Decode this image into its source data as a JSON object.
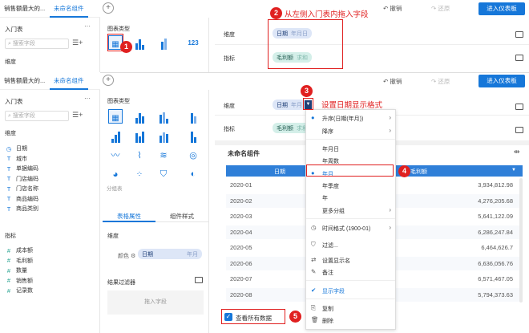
{
  "back_tabs": {
    "tab1": "销售额最大的...",
    "tab2": "未命名组件"
  },
  "back_header": {
    "undo": "撤销",
    "redo": "还原",
    "enter": "进入仪表板"
  },
  "back_left": {
    "title": "入门表",
    "search": "搜索字段",
    "dim": "维度"
  },
  "back_mid": {
    "chart_type": "图表类型"
  },
  "back_dims": {
    "row1": "维度",
    "row2": "指标",
    "chip1": "日期",
    "chip1_sub": "年月日",
    "chip2": "毛利额",
    "chip2_sub": "求和"
  },
  "front_tabs": {
    "tab1": "销售额最大的...",
    "tab2": "未命名组件"
  },
  "front_header": {
    "undo": "撤销",
    "redo": "还原",
    "enter": "进入仪表板"
  },
  "left": {
    "title": "入门表",
    "search": "搜索字段",
    "dim_label": "维度",
    "dims": [
      {
        "t": "T",
        "name": "日期",
        "kind": "date"
      },
      {
        "t": "T",
        "name": "城市"
      },
      {
        "t": "T",
        "name": "单据编码"
      },
      {
        "t": "T",
        "name": "门店编码"
      },
      {
        "t": "T",
        "name": "门店名称"
      },
      {
        "t": "T",
        "name": "商品编码"
      },
      {
        "t": "T",
        "name": "商品类别"
      }
    ],
    "metric_label": "指标",
    "metrics": [
      {
        "t": "#",
        "name": "成本额"
      },
      {
        "t": "#",
        "name": "毛利额"
      },
      {
        "t": "#",
        "name": "数量"
      },
      {
        "t": "#",
        "name": "销售额"
      },
      {
        "t": "#",
        "name": "记录数"
      }
    ]
  },
  "mid": {
    "chart_type": "图表类型",
    "group_label": "分组表",
    "tab_attr": "表格属性",
    "tab_style": "组件样式",
    "dim_label": "维度",
    "color_label": "颜色",
    "color_field": "日期",
    "color_sub": "年月",
    "filter_label": "结果过滤器",
    "drop_hint": "拖入字段"
  },
  "dims": {
    "row1": "维度",
    "row2": "指标",
    "chip1": "日期",
    "chip1_sub": "年月",
    "chip2": "毛利额",
    "chip2_sub": "求和"
  },
  "table": {
    "title": "未命名组件",
    "col1": "日期",
    "col2": "毛利额",
    "rows": [
      {
        "d": "2020-01",
        "v": "3,934,812.98"
      },
      {
        "d": "2020-02",
        "v": "4,276,205.68"
      },
      {
        "d": "2020-03",
        "v": "5,641,122.09"
      },
      {
        "d": "2020-04",
        "v": "6,286,247.84"
      },
      {
        "d": "2020-05",
        "v": "6,464,626.7"
      },
      {
        "d": "2020-06",
        "v": "6,636,056.76"
      },
      {
        "d": "2020-07",
        "v": "6,571,467.05"
      },
      {
        "d": "2020-08",
        "v": "5,794,373.63"
      }
    ],
    "show_all": "查看所有数据"
  },
  "menu": {
    "items": [
      {
        "label": "升序(日期(年月))",
        "dot": true,
        "arrow": true
      },
      {
        "label": "降序",
        "arrow": true
      },
      {
        "label": "年月日"
      },
      {
        "label": "年周数"
      },
      {
        "label": "年月",
        "dot": true
      },
      {
        "label": "年季度"
      },
      {
        "label": "年"
      },
      {
        "label": "更多分组",
        "arrow": true
      },
      {
        "label": "时间格式 (1900-01)",
        "icon": "clock-icon",
        "arrow": true
      },
      {
        "label": "过滤...",
        "icon": "filter-icon"
      },
      {
        "label": "设置显示名",
        "icon": "rename-icon"
      },
      {
        "label": "备注",
        "icon": "note-icon"
      },
      {
        "label": "显示字段",
        "icon": "check-icon"
      },
      {
        "label": "复制",
        "icon": "copy-icon"
      },
      {
        "label": "删除",
        "icon": "delete-icon"
      }
    ]
  },
  "annotations": {
    "n1": "1",
    "n2": "2",
    "n3": "3",
    "n4": "4",
    "n5": "5",
    "a2": "从左侧入门表内拖入字段",
    "a3": "设置日期显示格式"
  }
}
